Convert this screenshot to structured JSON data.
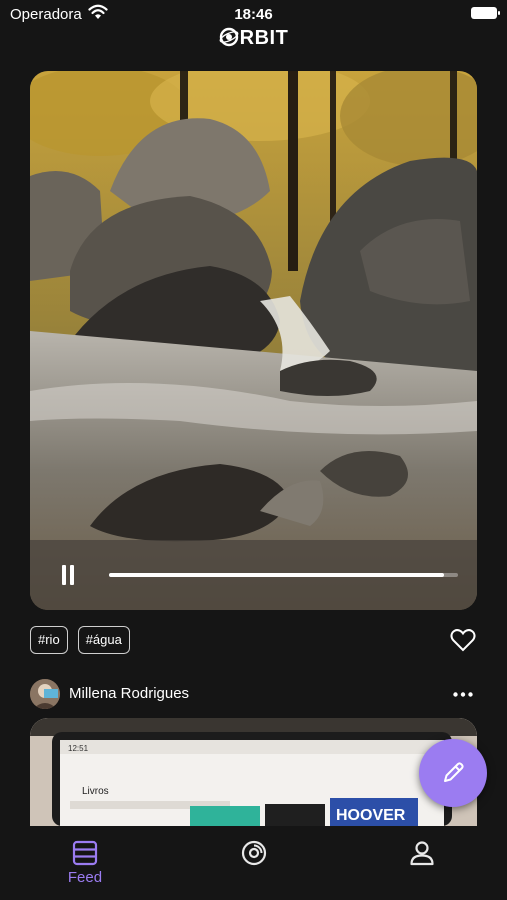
{
  "status_bar": {
    "carrier": "Operadora",
    "time": "18:46",
    "wifi_icon": "wifi-icon",
    "battery_icon": "battery-icon"
  },
  "header": {
    "logo_text": "RBIT",
    "logo_icon": "orbit-logo-icon"
  },
  "video_post": {
    "media": "forest-stream-waterfall-video",
    "playing": true,
    "control_icon": "pause-icon",
    "progress": 0.96,
    "tags": [
      "#rio",
      "#água"
    ],
    "like_icon": "heart-outline-icon"
  },
  "next_post": {
    "author_name": "Millena Rodrigues",
    "avatar_icon": "avatar",
    "more_icon": "more-horizontal-icon",
    "media": "tablet-screen-photo",
    "preview_texts": {
      "status": "12:51",
      "title": "Livros",
      "book": "HOOVER"
    }
  },
  "fab": {
    "icon": "pencil-icon"
  },
  "tab_bar": {
    "items": [
      {
        "label": "Feed",
        "icon": "feed-icon",
        "active": true
      },
      {
        "label": "",
        "icon": "disc-icon",
        "active": false
      },
      {
        "label": "",
        "icon": "profile-icon",
        "active": false
      }
    ]
  },
  "colors": {
    "background": "#151515",
    "accent": "#9b7cf1",
    "text": "#ffffff"
  }
}
